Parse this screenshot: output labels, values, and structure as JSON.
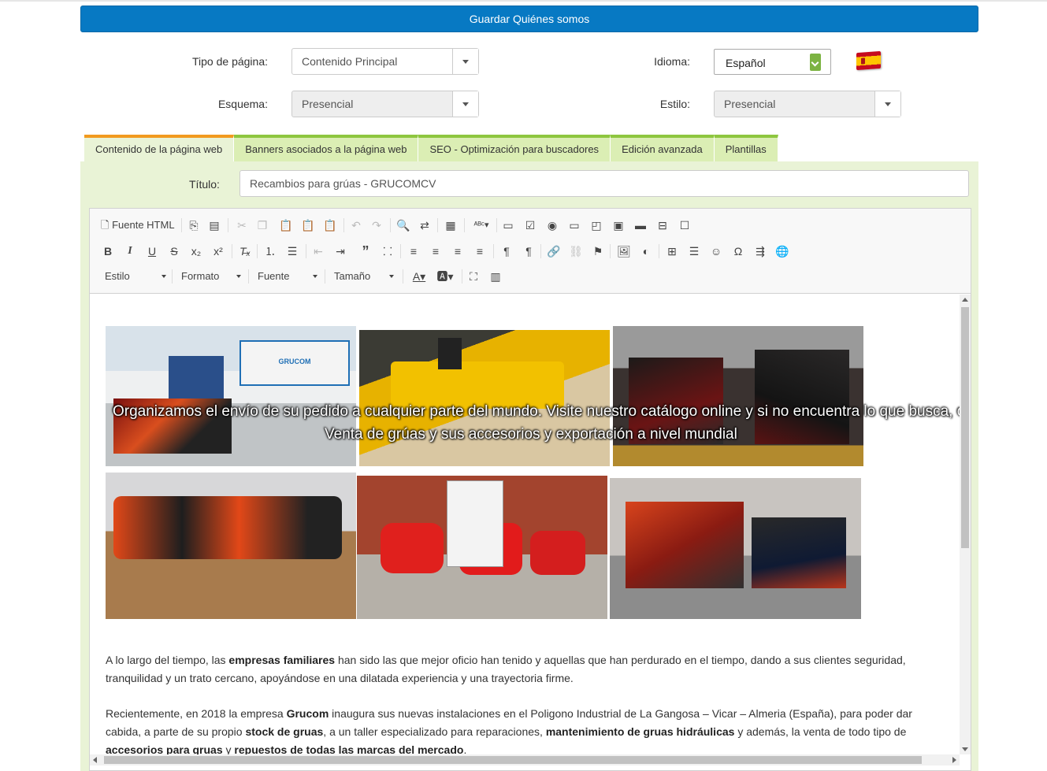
{
  "header": {
    "save_label": "Guardar Quiénes somos"
  },
  "form": {
    "tipo_label": "Tipo de página:",
    "tipo_value": "Contenido Principal",
    "idioma_label": "Idioma:",
    "idioma_value": "Español",
    "esquema_label": "Esquema:",
    "esquema_value": "Presencial",
    "estilo_label": "Estilo:",
    "estilo_value": "Presencial"
  },
  "tabs": [
    {
      "label": "Contenido de la página web",
      "active": true
    },
    {
      "label": "Banners asociados a la página web"
    },
    {
      "label": "SEO - Optimización para buscadores"
    },
    {
      "label": "Edición avanzada"
    },
    {
      "label": "Plantillas"
    }
  ],
  "title_field": {
    "label": "Título:",
    "value": "Recambios para grúas - GRUCOMCV"
  },
  "toolbar": {
    "source_label": "Fuente HTML",
    "combo_estilo": "Estilo",
    "combo_formato": "Formato",
    "combo_fuente": "Fuente",
    "combo_tamano": "Tamaño"
  },
  "content": {
    "brand_sign": "GRUCOM",
    "overlay_line1": "Organizamos el envío de su pedido a cualquier parte del mundo. Visite nuestro catálogo online y si no encuentra lo que busca, contacte con nosotros. Exportamos desde el puerto más cercano",
    "overlay_line2": "Venta de grúas y sus accesorios y exportación a nivel mundial",
    "p1": [
      {
        "t": "A lo largo del tiempo, las "
      },
      {
        "t": "empresas familiares",
        "b": true
      },
      {
        "t": " han sido las que mejor oficio han tenido y aquellas que han perdurado en el tiempo, dando a sus clientes seguridad, tranquilidad y un trato cercano, apoyándose en una dilatada experiencia y una trayectoria firme."
      }
    ],
    "p2": [
      {
        "t": "Recientemente, en 2018 la empresa "
      },
      {
        "t": "Grucom",
        "b": true
      },
      {
        "t": " inaugura sus nuevas instalaciones en el Poligono Industrial de La Gangosa – Vicar – Almeria (España), para poder dar cabida, a parte de su propio "
      },
      {
        "t": "stock de gruas",
        "b": true
      },
      {
        "t": ", a un taller especializado para reparaciones, "
      },
      {
        "t": "mantenimiento de gruas hidráulicas",
        "b": true
      },
      {
        "t": " y además, la venta de todo tipo de "
      },
      {
        "t": "accesorios para gruas",
        "b": true
      },
      {
        "t": " y "
      },
      {
        "t": "repuestos de todas las marcas del mercado",
        "b": true
      },
      {
        "t": "."
      }
    ]
  },
  "colors": {
    "primary": "#0779c3",
    "tab_green": "#8ec63f",
    "tab_active": "#f29a1f",
    "panel_bg": "#e9f3d6"
  }
}
